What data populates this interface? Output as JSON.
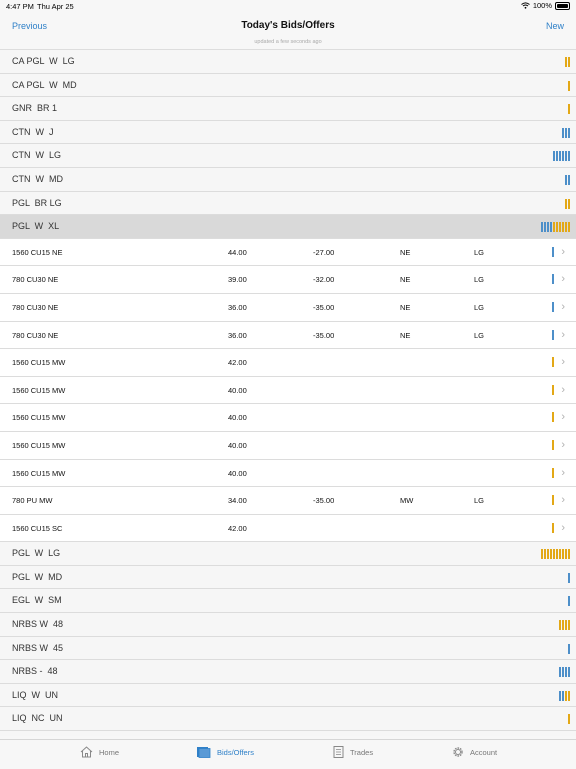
{
  "status_bar": {
    "time": "4:47 PM",
    "date": "Thu Apr 25",
    "battery": "100%"
  },
  "nav": {
    "back_label": "Previous",
    "title": "Today's Bids/Offers",
    "subtitle": "updated a few seconds ago",
    "new_label": "New"
  },
  "colors": {
    "accent": "#2f80c8",
    "bid_bar": "#4d8fc9",
    "offer_bar": "#e3a816"
  },
  "rows": [
    {
      "type": "group",
      "label": "CA PGL  W  LG",
      "bars": [
        "gold",
        "gold"
      ]
    },
    {
      "type": "group",
      "label": "CA PGL  W  MD",
      "bars": [
        "gold"
      ]
    },
    {
      "type": "group",
      "label": "GNR  BR 1",
      "bars": [
        "gold"
      ]
    },
    {
      "type": "group",
      "label": "CTN  W  J",
      "bars": [
        "blue",
        "blue",
        "blue"
      ]
    },
    {
      "type": "group",
      "label": "CTN  W  LG",
      "bars": [
        "blue",
        "blue",
        "blue",
        "blue",
        "blue",
        "blue"
      ]
    },
    {
      "type": "group",
      "label": "CTN  W  MD",
      "bars": [
        "blue",
        "blue"
      ]
    },
    {
      "type": "group",
      "label": "PGL  BR LG",
      "bars": [
        "gold",
        "gold"
      ]
    },
    {
      "type": "group",
      "label": "PGL  W  XL",
      "selected": true,
      "bars": [
        "blue",
        "blue",
        "blue",
        "blue",
        "gold",
        "gold",
        "gold",
        "gold",
        "gold",
        "gold"
      ]
    },
    {
      "type": "detail",
      "cols": [
        "1560 CU15 NE",
        "44.00",
        "-27.00",
        "NE",
        "LG"
      ],
      "bars": [
        "blue"
      ]
    },
    {
      "type": "detail",
      "cols": [
        "780 CU30 NE",
        "39.00",
        "-32.00",
        "NE",
        "LG"
      ],
      "bars": [
        "blue"
      ]
    },
    {
      "type": "detail",
      "cols": [
        "780 CU30 NE",
        "36.00",
        "-35.00",
        "NE",
        "LG"
      ],
      "bars": [
        "blue"
      ]
    },
    {
      "type": "detail",
      "cols": [
        "780 CU30 NE",
        "36.00",
        "-35.00",
        "NE",
        "LG"
      ],
      "bars": [
        "blue"
      ]
    },
    {
      "type": "detail",
      "cols": [
        "1560 CU15 MW",
        "42.00",
        "",
        "",
        ""
      ],
      "bars": [
        "gold"
      ]
    },
    {
      "type": "detail",
      "cols": [
        "1560 CU15 MW",
        "40.00",
        "",
        "",
        ""
      ],
      "bars": [
        "gold"
      ]
    },
    {
      "type": "detail",
      "cols": [
        "1560 CU15 MW",
        "40.00",
        "",
        "",
        ""
      ],
      "bars": [
        "gold"
      ]
    },
    {
      "type": "detail",
      "cols": [
        "1560 CU15 MW",
        "40.00",
        "",
        "",
        ""
      ],
      "bars": [
        "gold"
      ]
    },
    {
      "type": "detail",
      "cols": [
        "1560 CU15 MW",
        "40.00",
        "",
        "",
        ""
      ],
      "bars": [
        "gold"
      ]
    },
    {
      "type": "detail",
      "cols": [
        "780 PU MW",
        "34.00",
        "-35.00",
        "MW",
        "LG"
      ],
      "bars": [
        "gold"
      ]
    },
    {
      "type": "detail",
      "cols": [
        "1560 CU15 SC",
        "42.00",
        "",
        "",
        ""
      ],
      "bars": [
        "gold"
      ]
    },
    {
      "type": "group",
      "label": "PGL  W  LG",
      "bars": [
        "gold",
        "gold",
        "gold",
        "gold",
        "gold",
        "gold",
        "gold",
        "gold",
        "gold",
        "gold"
      ]
    },
    {
      "type": "group",
      "label": "PGL  W  MD",
      "bars": [
        "blue"
      ]
    },
    {
      "type": "group",
      "label": "EGL  W  SM",
      "bars": [
        "blue"
      ]
    },
    {
      "type": "group",
      "label": "NRBS W  48",
      "bars": [
        "gold",
        "gold",
        "gold",
        "gold"
      ]
    },
    {
      "type": "group",
      "label": "NRBS W  45",
      "bars": [
        "blue"
      ]
    },
    {
      "type": "group",
      "label": "NRBS -  48",
      "bars": [
        "blue",
        "blue",
        "blue",
        "blue"
      ]
    },
    {
      "type": "group",
      "label": "LIQ  W  UN",
      "bars": [
        "blue",
        "blue",
        "gold",
        "gold"
      ]
    },
    {
      "type": "group",
      "label": "LIQ  NC  UN",
      "bars": [
        "gold"
      ]
    },
    {
      "type": "group",
      "label": "",
      "bars": []
    }
  ],
  "tabs": [
    {
      "label": "Home",
      "icon": "home-icon"
    },
    {
      "label": "Bids/Offers",
      "icon": "bids-offers-icon",
      "active": true
    },
    {
      "label": "Trades",
      "icon": "trades-icon"
    },
    {
      "label": "Account",
      "icon": "gear-icon"
    }
  ]
}
